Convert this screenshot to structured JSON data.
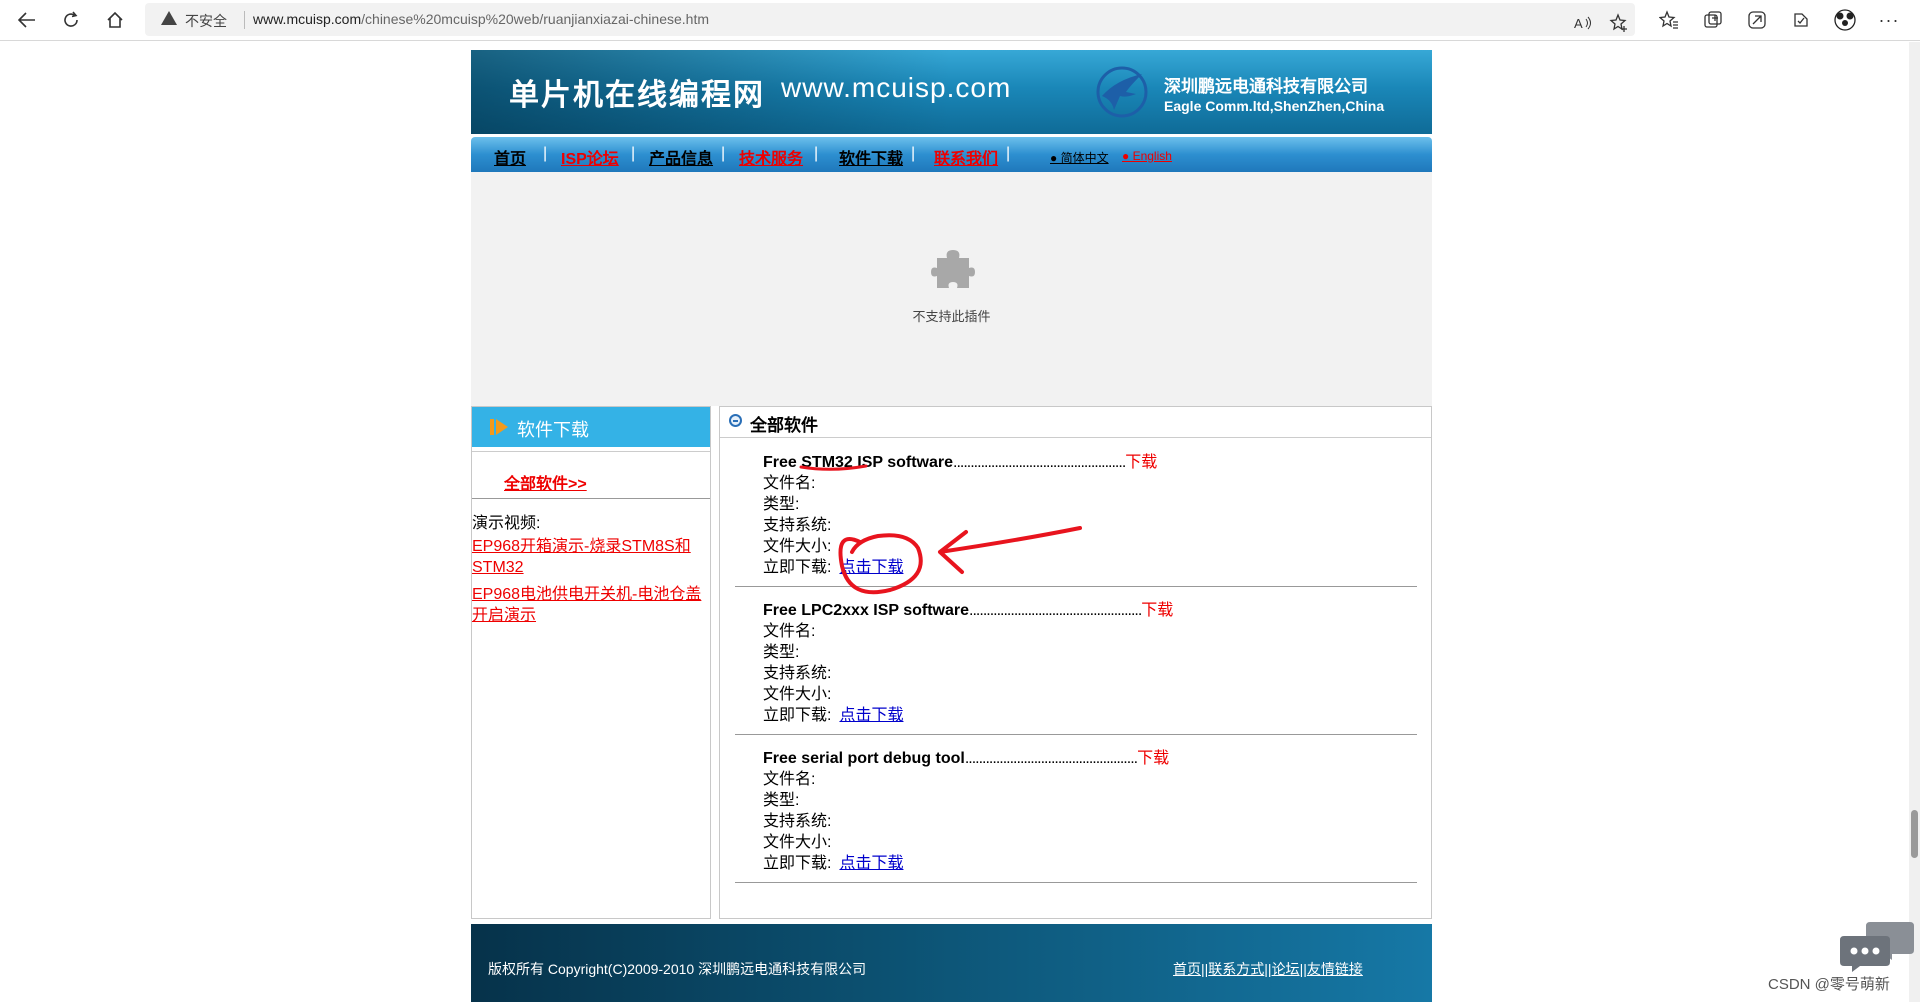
{
  "browser": {
    "security_label": "不安全",
    "url_host": "www.mcuisp.com",
    "url_path": "/chinese%20mcuisp%20web/ruanjianxiazai-chinese.htm"
  },
  "banner": {
    "title": "单片机在线编程网",
    "url": "www.mcuisp.com",
    "company_cn": "深圳鹏远电通科技有限公司",
    "company_en": "Eagle Comm.ltd,ShenZhen,China"
  },
  "nav": {
    "items": [
      {
        "label": "首页",
        "color": "#000000"
      },
      {
        "label": "ISP论坛",
        "color": "#ee0000"
      },
      {
        "label": "产品信息",
        "color": "#000000"
      },
      {
        "label": "技术服务",
        "color": "#ee0000"
      },
      {
        "label": "软件下载",
        "color": "#000000"
      },
      {
        "label": "联系我们",
        "color": "#ee0000"
      }
    ],
    "separator": "|",
    "lang_cn": "● 简体中文",
    "lang_en": "● English"
  },
  "plugin": {
    "message": "不支持此插件"
  },
  "sidebar": {
    "heading": "软件下载",
    "all_link": "全部软件>>",
    "demo_label": "演示视频:",
    "demos": [
      {
        "label": "EP968开箱演示-烧录STM8S和STM32"
      },
      {
        "label": "EP968电池供电开关机-电池仓盖开启演示"
      }
    ]
  },
  "main": {
    "heading": "全部软件",
    "field_labels": {
      "filename": "文件名:",
      "type": "类型:",
      "os": "支持系统:",
      "size": "文件大小:",
      "download_now": "立即下载:"
    },
    "items": [
      {
        "title": "Free STM32 ISP software",
        "dots": "..................................................",
        "download": "下载",
        "link": "点击下载"
      },
      {
        "title": "Free LPC2xxx ISP software",
        "dots": "..................................................",
        "download": "下载",
        "link": "点击下载"
      },
      {
        "title": "Free serial port debug tool",
        "dots": "..................................................",
        "download": "下载",
        "link": "点击下载"
      }
    ]
  },
  "footer": {
    "copyright": "版权所有 Copyright(C)2009-2010 深圳鹏远电通科技有限公司",
    "links": [
      "首页",
      "联系方式",
      "论坛",
      "友情链接"
    ],
    "link_sep": "||"
  },
  "watermark": "CSDN @零号萌新",
  "colors": {
    "banner_blue": "#1a87b8",
    "nav_blue": "#2d8fd0",
    "sidebar_head": "#34b2e6",
    "link_red": "#ee0000",
    "link_blue": "#0000cc",
    "annotation_red": "#e8141e"
  }
}
